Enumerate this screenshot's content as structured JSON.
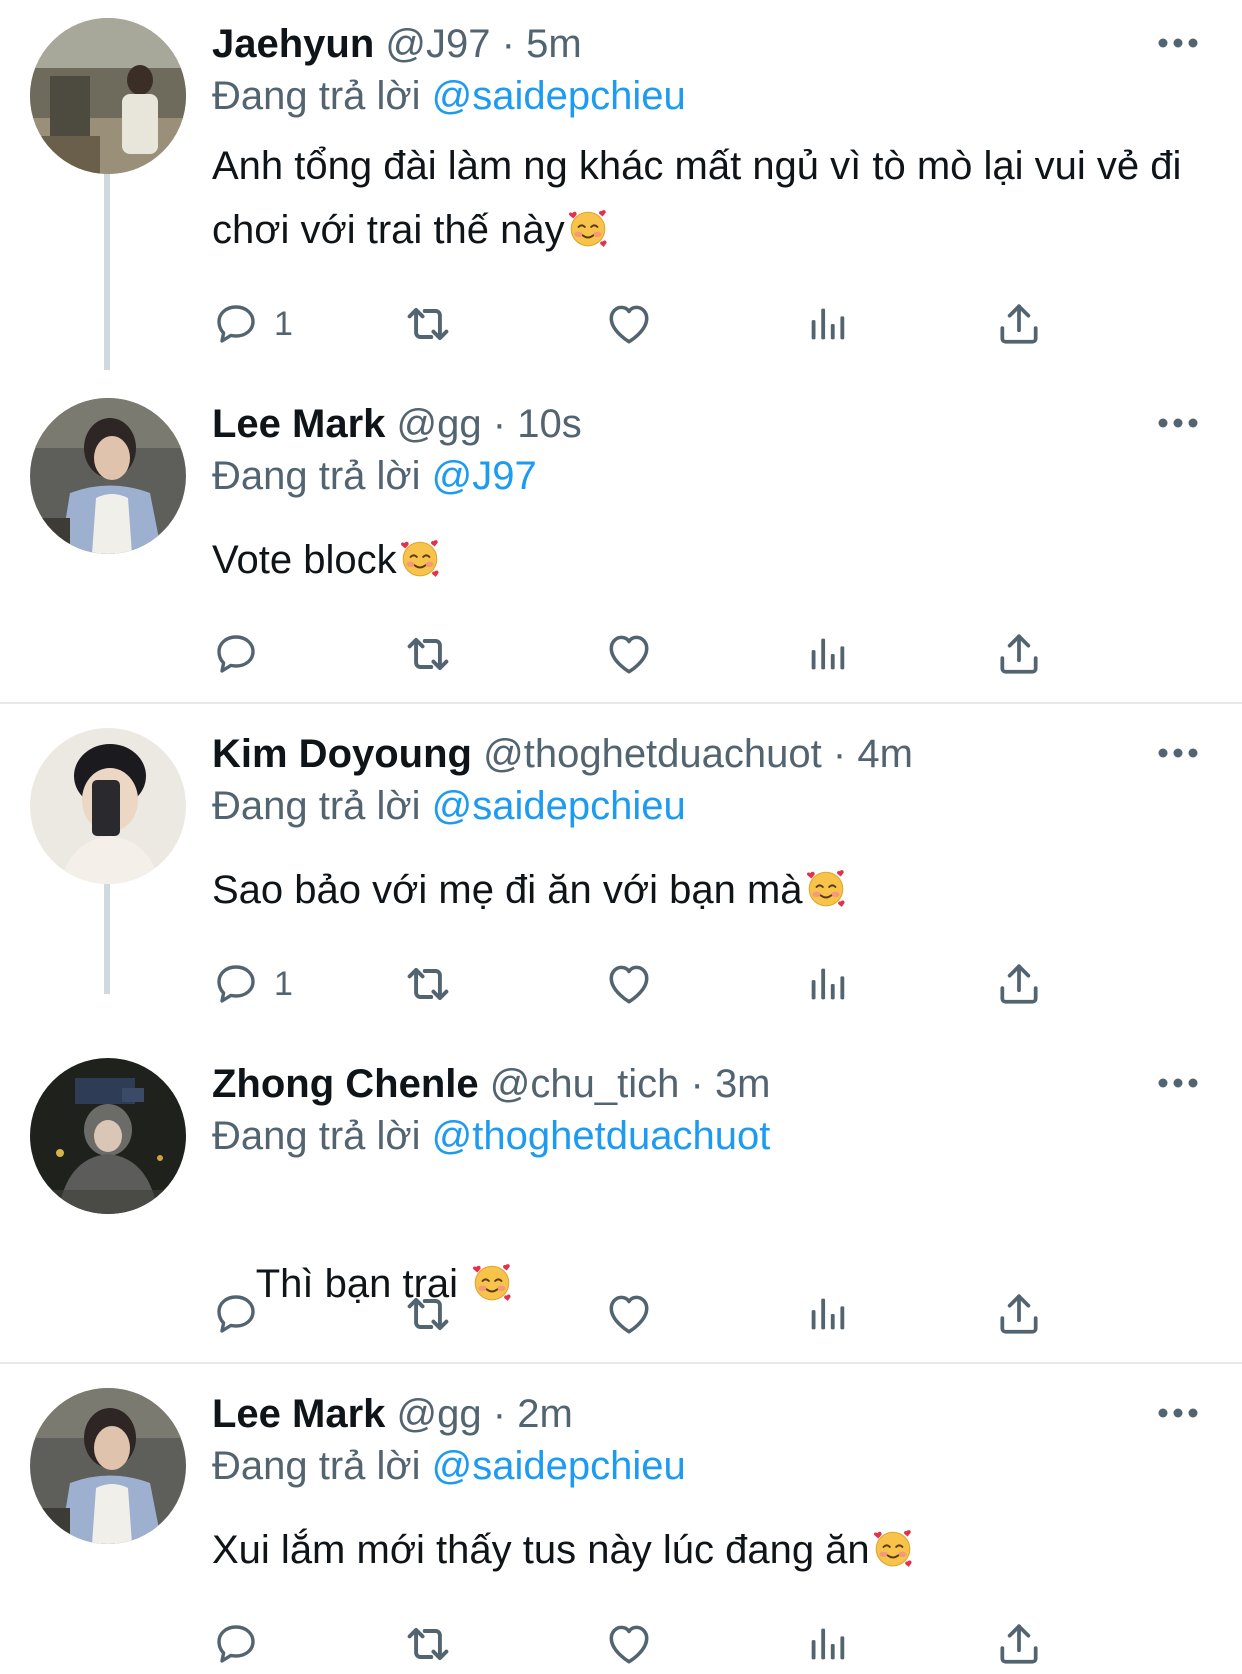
{
  "colors": {
    "accent": "#1d9bf0",
    "text": "#0f1419",
    "muted": "#536471",
    "line": "#cfd9de"
  },
  "tweets": [
    {
      "name": "Jaehyun",
      "handle": "@J97",
      "time": "5m",
      "reply_prefix": "Đang trả lời",
      "reply_to": "@saidepchieu",
      "text": "Anh tổng đài làm ng khác mất ngủ vì tò mò lại vui vẻ đi chơi với trai thế này",
      "emoji": "smiling-face-with-hearts",
      "reply_count": "1",
      "avatar": "avatar-jaehyun"
    },
    {
      "name": "Lee Mark",
      "handle": "@gg",
      "time": "10s",
      "reply_prefix": "Đang trả lời",
      "reply_to": "@J97",
      "text": "Vote block",
      "emoji": "smiling-face-with-hearts",
      "reply_count": "",
      "avatar": "avatar-lee-mark"
    },
    {
      "name": "Kim Doyoung",
      "handle": "@thoghetduachuot",
      "time": "4m",
      "reply_prefix": "Đang trả lời",
      "reply_to": "@saidepchieu",
      "text": "Sao bảo với mẹ đi ăn với bạn mà",
      "emoji": "smiling-face-with-hearts",
      "reply_count": "1",
      "avatar": "avatar-kim-doyoung"
    },
    {
      "name": "Zhong Chenle",
      "handle": "@chu_tich",
      "time": "3m",
      "reply_prefix": "Đang trả lời",
      "reply_to": "@thoghetduachuot",
      "text": "Thì bạn trai ",
      "emoji": "smiling-face-with-hearts",
      "reply_count": "",
      "avatar": "avatar-zhong-chenle"
    },
    {
      "name": "Lee Mark",
      "handle": "@gg",
      "time": "2m",
      "reply_prefix": "Đang trả lời",
      "reply_to": "@saidepchieu",
      "text": "Xui lắm mới thấy tus này lúc đang ăn",
      "emoji": "smiling-face-with-hearts",
      "reply_count": "",
      "avatar": "avatar-lee-mark"
    }
  ],
  "separator": "·",
  "icons": [
    "reply-icon",
    "retweet-icon",
    "like-icon",
    "views-icon",
    "share-icon",
    "more-icon"
  ]
}
